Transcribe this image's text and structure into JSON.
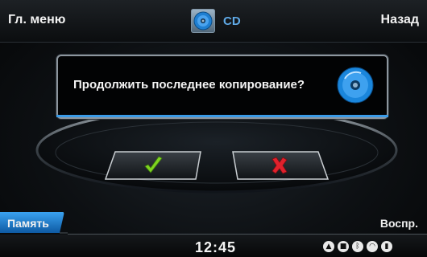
{
  "header": {
    "main_menu_label": "Гл. меню",
    "source_label": "CD",
    "back_label": "Назад"
  },
  "dialog": {
    "message": "Продолжить последнее копирование?"
  },
  "buttons": {
    "confirm_icon": "check-icon",
    "cancel_icon": "cross-icon"
  },
  "softkeys": {
    "left_label": "Память",
    "right_label": "Воспр."
  },
  "status": {
    "clock": "12:45",
    "icons": [
      "navigation-icon",
      "phone-icon",
      "bluetooth-icon",
      "wifi-icon",
      "signal-icon"
    ]
  },
  "colors": {
    "accent_blue": "#3a9be8",
    "source_text": "#5fa9e6",
    "check_green": "#7ed321",
    "cross_red": "#e0212c"
  }
}
